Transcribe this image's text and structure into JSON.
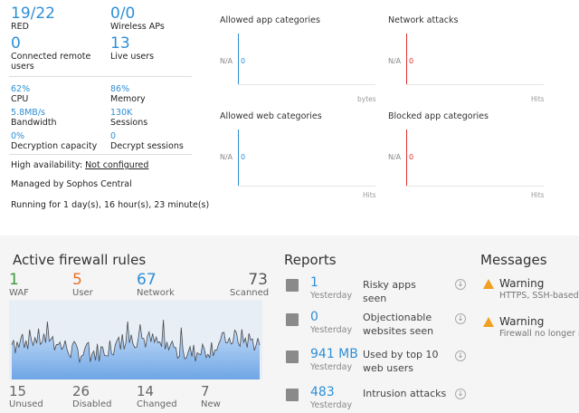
{
  "stats": {
    "red_value": "19",
    "red_total": "/22",
    "red_label": "RED",
    "wireless_value": "0",
    "wireless_total": "/0",
    "wireless_label": "Wireless APs",
    "remote_value": "0",
    "remote_label": "Connected remote users",
    "live_value": "13",
    "live_label": "Live users",
    "cpu_value": "62%",
    "cpu_label": "CPU",
    "memory_value": "86%",
    "memory_label": "Memory",
    "bandwidth_value": "5.8MB/s",
    "bandwidth_label": "Bandwidth",
    "sessions_value": "130K",
    "sessions_label": "Sessions",
    "decap_value": "0%",
    "decap_label": "Decryption capacity",
    "decsess_value": "0",
    "decsess_label": "Decrypt sessions",
    "ha_label": "High availability:",
    "ha_value": "Not configured",
    "managed": "Managed by Sophos Central",
    "running": "Running for 1 day(s), 16 hour(s), 23 minute(s)"
  },
  "mini_charts": [
    {
      "title": "Allowed app categories",
      "na": "N/A",
      "value": "0",
      "unit": "bytes",
      "color": "#2e8fd6"
    },
    {
      "title": "Network attacks",
      "na": "N/A",
      "value": "0",
      "unit": "Hits",
      "color": "#e03030"
    },
    {
      "title": "Allowed web categories",
      "na": "N/A",
      "value": "0",
      "unit": "Hits",
      "color": "#2e8fd6"
    },
    {
      "title": "Blocked app categories",
      "na": "N/A",
      "value": "0",
      "unit": "Hits",
      "color": "#e03030"
    }
  ],
  "firewall": {
    "title": "Active firewall rules",
    "waf_value": "1",
    "waf_label": "WAF",
    "waf_color": "#3a9a3a",
    "user_value": "5",
    "user_label": "User",
    "user_color": "#e8702a",
    "network_value": "67",
    "network_label": "Network",
    "network_color": "#2e8fd6",
    "scanned_value": "73",
    "scanned_label": "Scanned",
    "unused_value": "15",
    "unused_label": "Unused",
    "disabled_value": "26",
    "disabled_label": "Disabled",
    "changed_value": "14",
    "changed_label": "Changed",
    "new_value": "7",
    "new_label": "New"
  },
  "reports": {
    "title": "Reports",
    "items": [
      {
        "value": "1",
        "sub": "Yesterday",
        "text": "Risky apps seen"
      },
      {
        "value": "0",
        "sub": "Yesterday",
        "text": "Objectionable websites seen"
      },
      {
        "value": "941 MB",
        "sub": "Yesterday",
        "text": "Used by top 10 web users"
      },
      {
        "value": "483",
        "sub": "Yesterday",
        "text": "Intrusion attacks"
      }
    ]
  },
  "messages": {
    "title": "Messages",
    "items": [
      {
        "title": "Warning",
        "sub": "HTTPS, SSH-based r"
      },
      {
        "title": "Warning",
        "sub": "Firewall no longer re"
      }
    ]
  }
}
